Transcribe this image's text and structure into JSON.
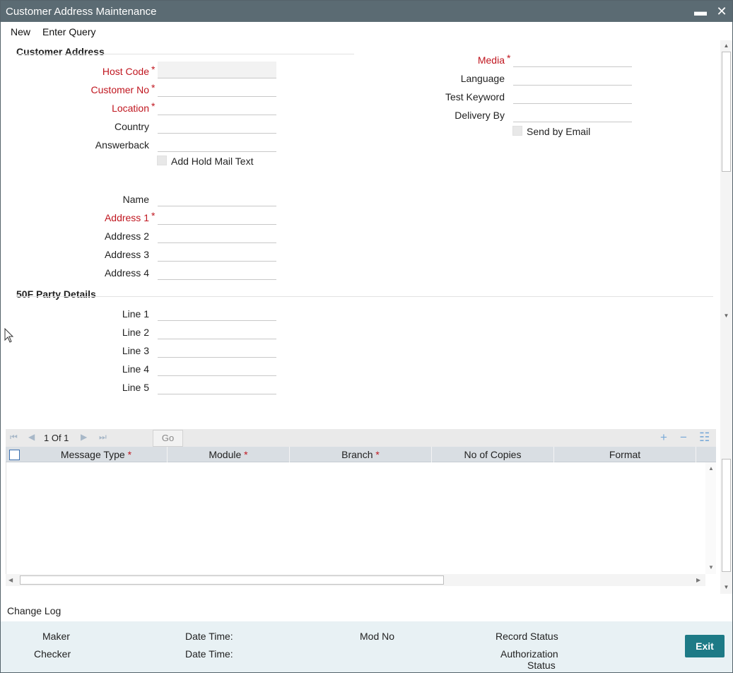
{
  "window": {
    "title": "Customer Address Maintenance",
    "minimize_glyph": "▬",
    "close_glyph": "✕"
  },
  "menu": {
    "new": "New",
    "enter_query": "Enter Query"
  },
  "customer_address": {
    "section_title": "Customer Address",
    "host_code": {
      "label": "Host Code",
      "value": ""
    },
    "customer_no": {
      "label": "Customer No",
      "value": ""
    },
    "location": {
      "label": "Location",
      "value": ""
    },
    "country": {
      "label": "Country",
      "value": ""
    },
    "answerback": {
      "label": "Answerback",
      "value": ""
    },
    "add_hold_mail_text": {
      "label": "Add Hold Mail Text",
      "checked": false
    },
    "media": {
      "label": "Media",
      "value": ""
    },
    "language": {
      "label": "Language",
      "value": ""
    },
    "test_keyword": {
      "label": "Test Keyword",
      "value": ""
    },
    "delivery_by": {
      "label": "Delivery By",
      "value": ""
    },
    "send_by_email": {
      "label": "Send by Email",
      "checked": false
    },
    "name": {
      "label": "Name",
      "value": ""
    },
    "address1": {
      "label": "Address 1",
      "value": ""
    },
    "address2": {
      "label": "Address 2",
      "value": ""
    },
    "address3": {
      "label": "Address 3",
      "value": ""
    },
    "address4": {
      "label": "Address 4",
      "value": ""
    },
    "required_marker": "*"
  },
  "party_details": {
    "section_title": "50F Party Details",
    "line1": {
      "label": "Line 1",
      "value": ""
    },
    "line2": {
      "label": "Line 2",
      "value": ""
    },
    "line3": {
      "label": "Line 3",
      "value": ""
    },
    "line4": {
      "label": "Line 4",
      "value": ""
    },
    "line5": {
      "label": "Line 5",
      "value": ""
    }
  },
  "grid": {
    "pager": "1 Of 1",
    "go_label": "Go",
    "add_glyph": "+",
    "remove_glyph": "−",
    "columns": [
      {
        "label": "Message Type",
        "required": true
      },
      {
        "label": "Module",
        "required": true
      },
      {
        "label": "Branch",
        "required": true
      },
      {
        "label": "No of Copies",
        "required": false
      },
      {
        "label": "Format",
        "required": false
      }
    ],
    "rows": [],
    "required_star": "*"
  },
  "footer": {
    "change_log": "Change Log",
    "maker": "Maker",
    "checker": "Checker",
    "date_time_1": "Date Time:",
    "date_time_2": "Date Time:",
    "mod_no": "Mod No",
    "record_status": "Record Status",
    "authorization_status_1": "Authorization",
    "authorization_status_2": "Status",
    "exit_label": "Exit"
  },
  "colors": {
    "titlebar": "#5b6b73",
    "required": "#c0161f",
    "exit_button": "#1d7a86",
    "footer_bg": "#e8f1f4",
    "grid_header": "#d9dee3"
  }
}
